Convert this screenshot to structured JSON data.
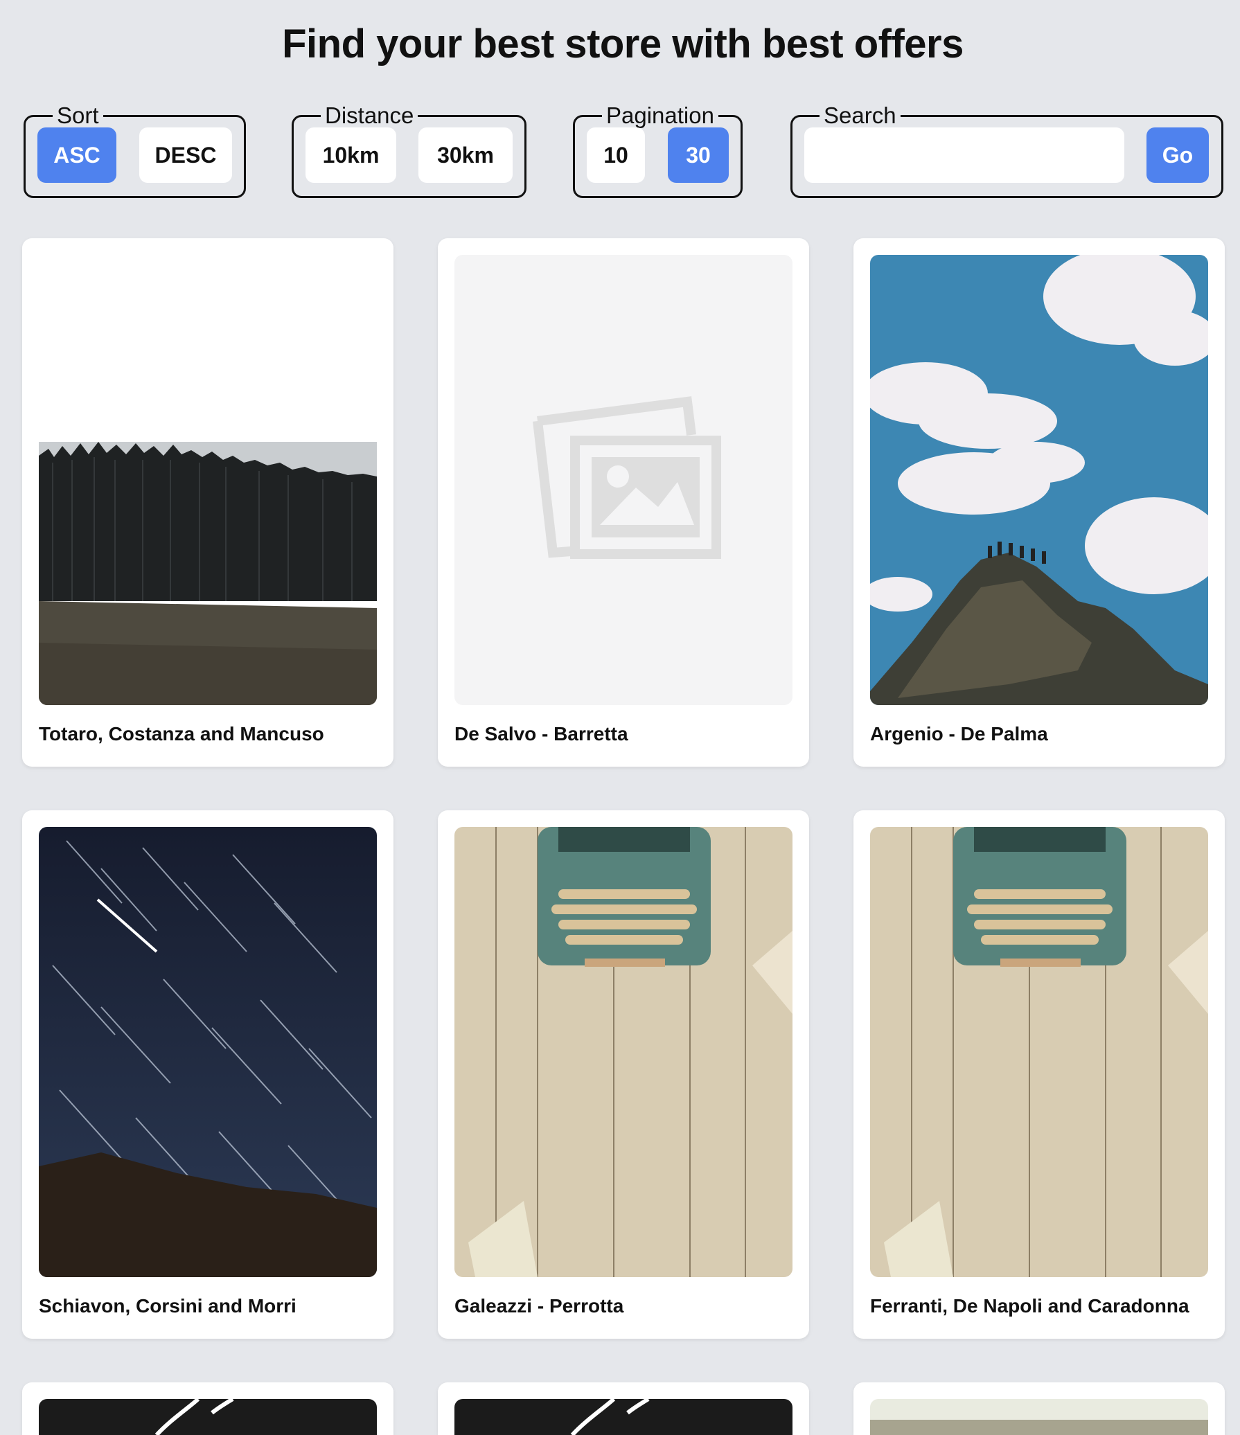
{
  "header": {
    "title": "Find your best store with best offers"
  },
  "filters": {
    "sort": {
      "legend": "Sort",
      "options": [
        "ASC",
        "DESC"
      ],
      "selected": "ASC"
    },
    "distance": {
      "legend": "Distance",
      "options": [
        "10km",
        "30km"
      ],
      "selected": null
    },
    "pagination": {
      "legend": "Pagination",
      "options": [
        "10",
        "30"
      ],
      "selected": "30"
    },
    "search": {
      "legend": "Search",
      "value": "",
      "placeholder": "",
      "button_label": "Go"
    }
  },
  "colors": {
    "accent": "#4f82ee",
    "background": "#e5e7eb",
    "card": "#ffffff"
  },
  "stores": [
    {
      "name": "Totaro, Costanza and Mancuso",
      "image": "forest-field-photo"
    },
    {
      "name": "De Salvo - Barretta",
      "image": "image-placeholder-icon"
    },
    {
      "name": "Argenio - De Palma",
      "image": "mountain-sky-photo"
    },
    {
      "name": "Schiavon, Corsini and Morri",
      "image": "star-trails-photo"
    },
    {
      "name": "Galeazzi - Perrotta",
      "image": "typewriter-photo"
    },
    {
      "name": "Ferranti, De Napoli and Caradonna",
      "image": "typewriter-photo"
    },
    {
      "name": "",
      "image": "handwriting-dark-photo"
    },
    {
      "name": "",
      "image": "handwriting-dark-photo"
    },
    {
      "name": "",
      "image": "blurred-landscape-photo"
    }
  ]
}
